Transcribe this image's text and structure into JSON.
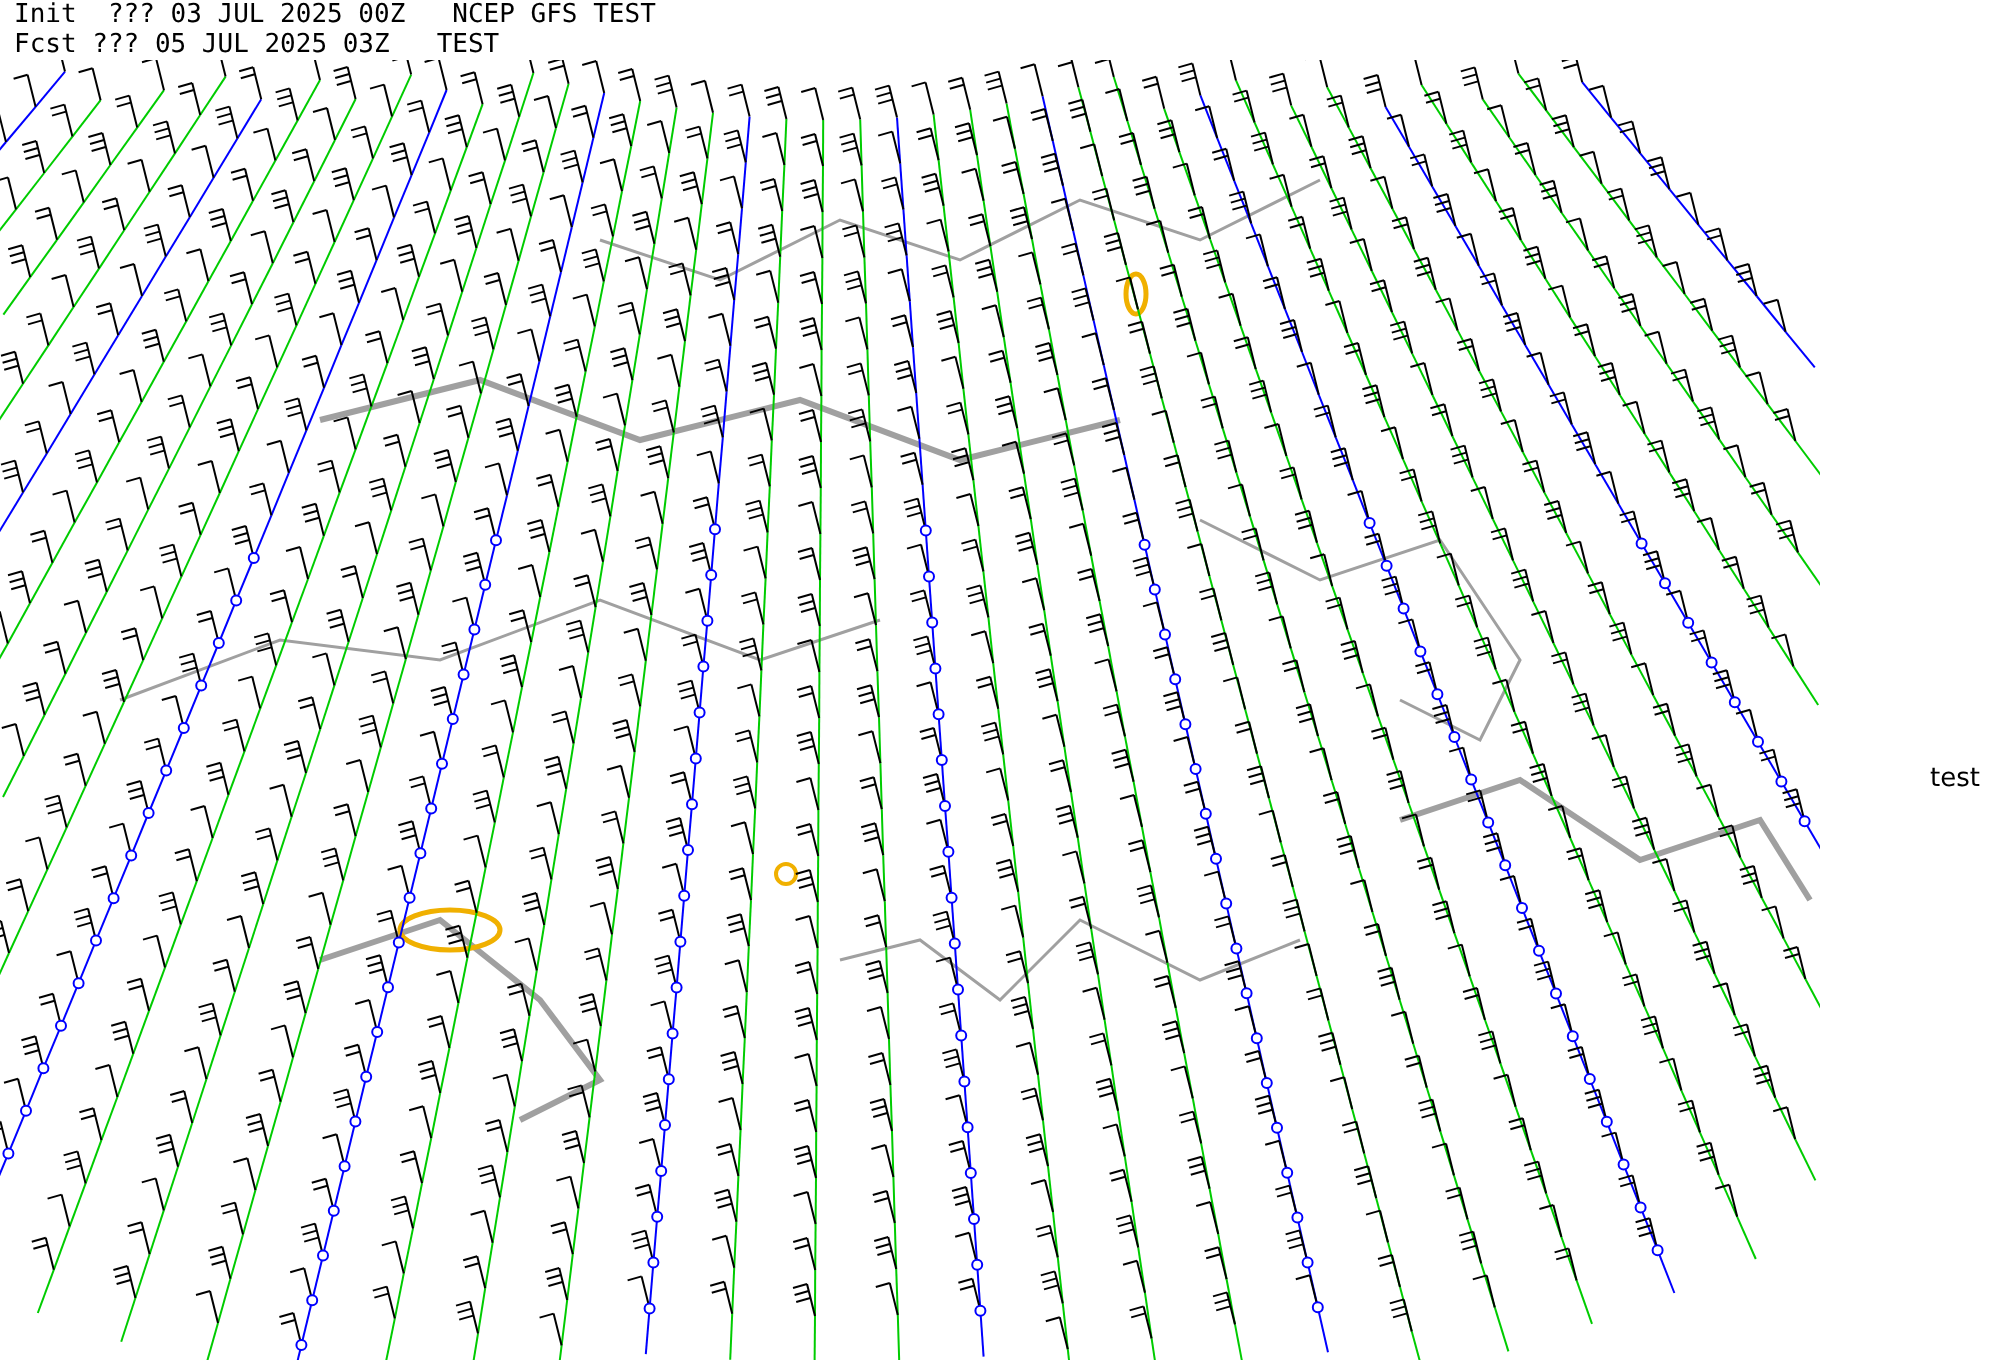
{
  "header": {
    "init_line": "Init  ??? 03 JUL 2025 00Z   NCEP GFS TEST",
    "forecast_line": "Fcst ??? 05 JUL 2025 03Z   TEST"
  },
  "side_label": "test"
}
